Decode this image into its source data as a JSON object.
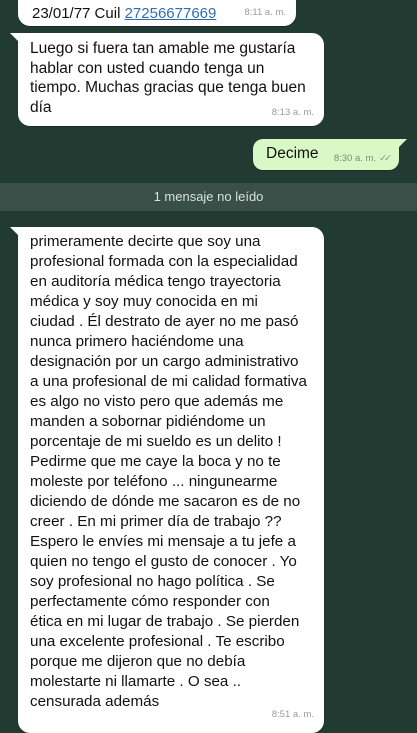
{
  "top_message": {
    "prefix": "23/01/77 Cuil ",
    "phone": "27256677669",
    "time": "8:11 a. m."
  },
  "message_1": {
    "text": "Luego si fuera tan amable me gustaría hablar con usted cuando tenga un tiempo. Muchas gracias que tenga buen día",
    "time": "8:13 a. m."
  },
  "outgoing": {
    "text": "Decime",
    "time": "8:30 a. m.",
    "status_icon": "double-check-icon",
    "ticks": "✓✓"
  },
  "unread_divider": "1 mensaje no leído",
  "message_2": {
    "lines": [
      "primeramente decirte que soy una",
      "profesional formada con la especialidad",
      "en auditoría médica  tengo trayectoria",
      "médica y soy muy conocida en mi",
      "ciudad . Él destrato de ayer  no me pasó",
      "nunca primero haciéndome una",
      "designación por un cargo administrativo",
      "a una profesional de mi calidad formativa",
      "es algo no visto pero que además me",
      "manden a sobornar pidiéndome un",
      "porcentaje de mi sueldo es un delito !",
      "Pedirme que me caye la boca y no te",
      "moleste por teléfono  ... ningunearme",
      "diciendo de dónde me sacaron es de no",
      "creer . En mi primer día de trabajo ??",
      "Espero le envíes mi mensaje a tu jefe a",
      "quien no tengo el gusto de conocer  . Yo",
      "soy profesional no hago política . Se",
      "perfectamente cómo responder con",
      "ética en mi lugar de trabajo . Se pierden",
      "una excelente profesional . Te escribo",
      "porque me dijeron que no debía",
      "molestarte ni llamarte . O sea ..",
      "censurada además"
    ],
    "time": "8:51 a. m."
  }
}
